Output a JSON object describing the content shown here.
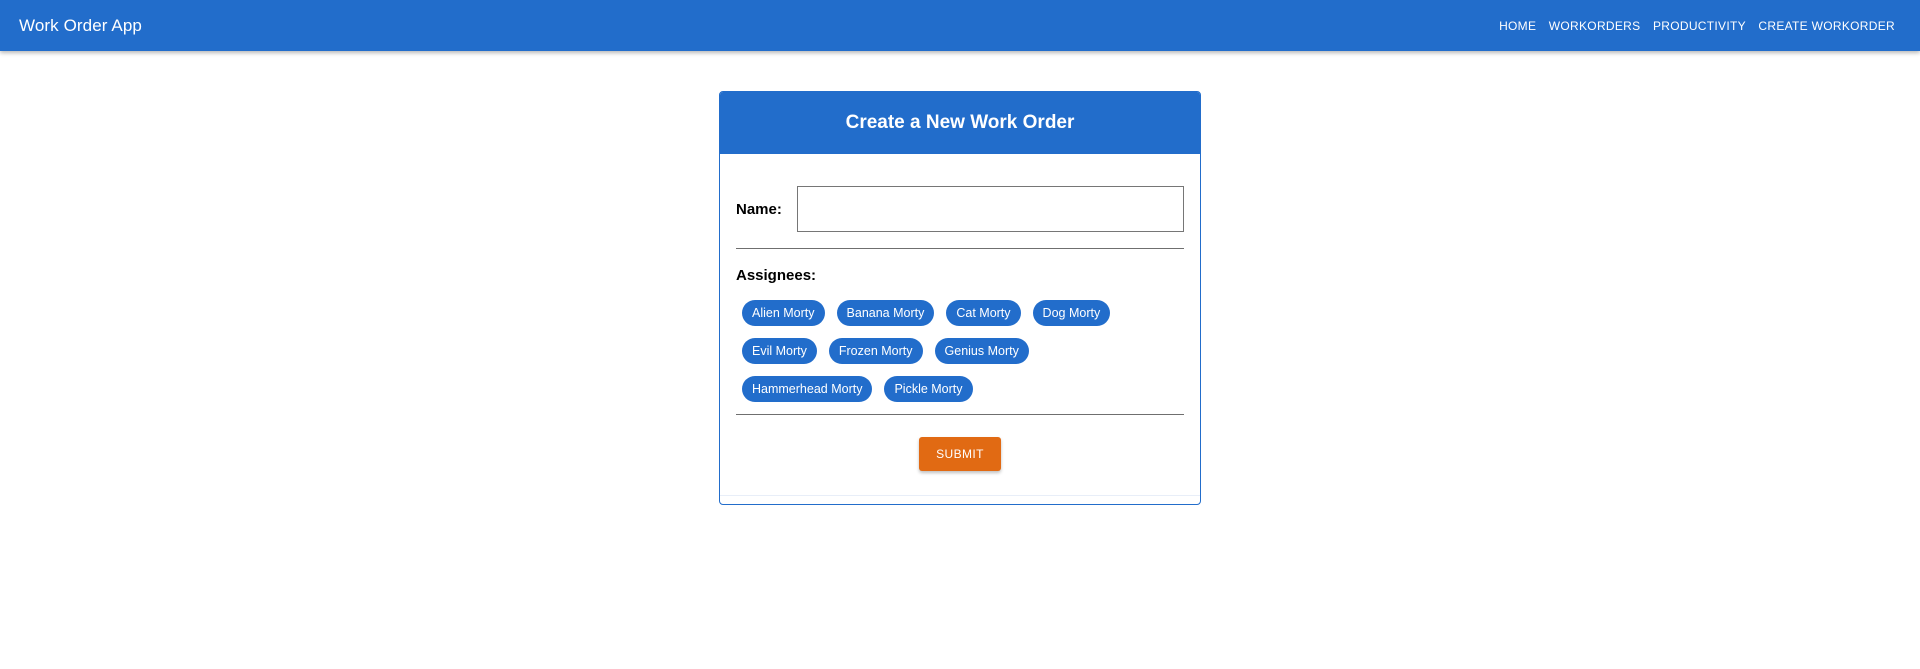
{
  "appbar": {
    "title": "Work Order App",
    "nav": [
      "HOME",
      "WORKORDERS",
      "PRODUCTIVITY",
      "CREATE WORKORDER"
    ]
  },
  "form": {
    "title": "Create a New Work Order",
    "name_label": "Name:",
    "name_value": "",
    "assignees_label": "Assignees:",
    "assignees": [
      [
        "Alien Morty",
        "Banana Morty",
        "Cat Morty",
        "Dog Morty"
      ],
      [
        "Evil Morty",
        "Frozen Morty",
        "Genius Morty"
      ],
      [
        "Hammerhead Morty",
        "Pickle Morty"
      ]
    ],
    "submit_label": "SUBMIT"
  },
  "colors": {
    "primary": "#226dcb",
    "accent": "#e16a13"
  }
}
